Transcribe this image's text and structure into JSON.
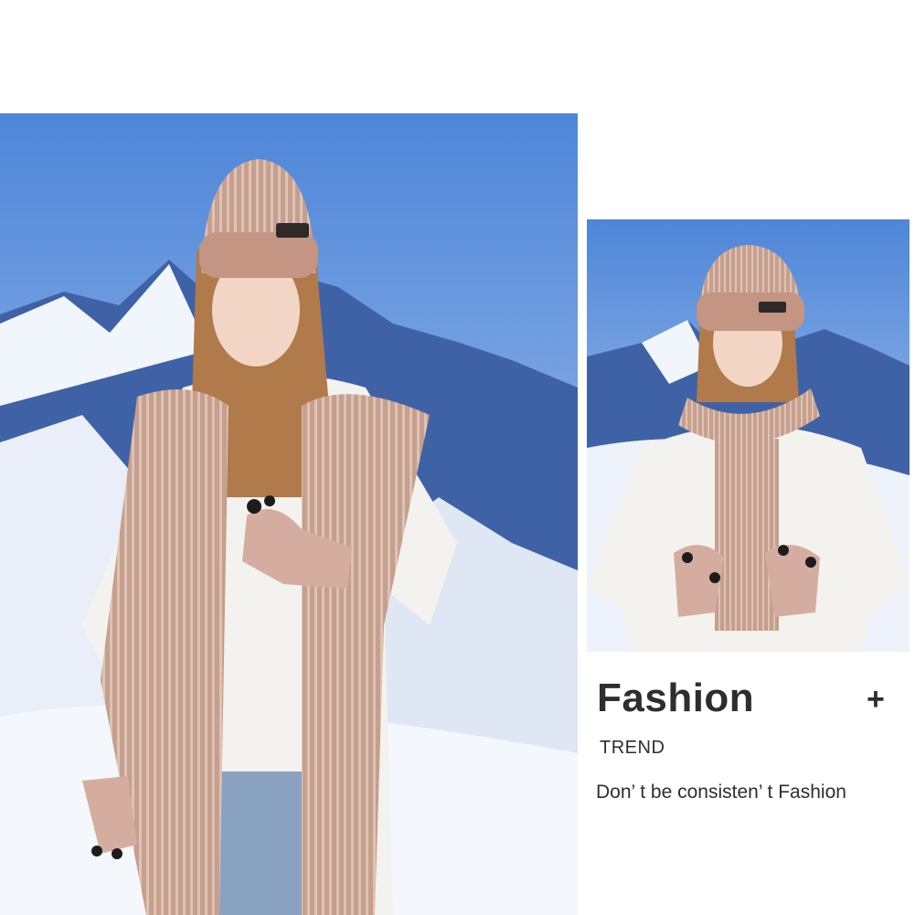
{
  "promo": {
    "headline": "Fashion",
    "plus_symbol": "+",
    "subhead": "TREND",
    "tagline": "Don’ t be consisten’ t Fashion"
  },
  "photos": [
    {
      "subject": "woman wearing knit beanie, long knit scarf draped over shoulders and touchscreen gloves, snowy mountain backdrop"
    },
    {
      "subject": "woman wearing knit beanie, scarf wrapped around neck and touchscreen gloves, snowy mountain backdrop"
    }
  ],
  "colors": {
    "knit": "#c59c8a",
    "knit_light": "#dcc0b2",
    "sky": "#6f9bdd",
    "snow": "#eef3fb",
    "sweater": "#f4f2ef",
    "text": "#2e2e2e"
  }
}
